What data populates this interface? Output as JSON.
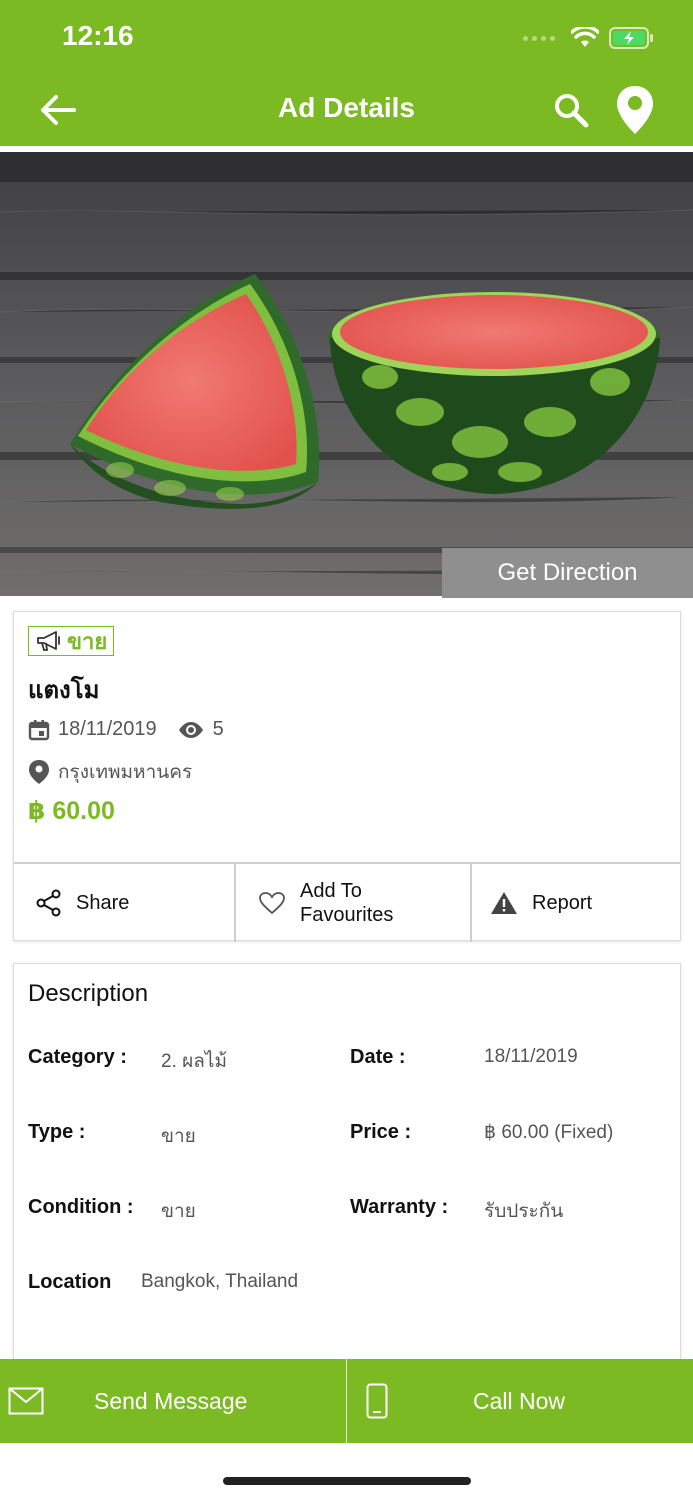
{
  "status_bar": {
    "time": "12:16"
  },
  "header": {
    "title": "Ad Details"
  },
  "hero": {
    "get_direction_label": "Get Direction"
  },
  "ad": {
    "tag": "ขาย",
    "title": "แตงโม",
    "date": "18/11/2019",
    "views": "5",
    "location": "กรุงเทพมหานคร",
    "price": "฿ 60.00"
  },
  "actions": {
    "share": "Share",
    "favourites_line1": "Add To",
    "favourites_line2": "Favourites",
    "report": "Report"
  },
  "description": {
    "title": "Description",
    "category_label": "Category :",
    "category_value": "2. ผลไม้",
    "date_label": "Date :",
    "date_value": "18/11/2019",
    "type_label": "Type :",
    "type_value": "ขาย",
    "price_label": "Price :",
    "price_value": "฿ 60.00 (Fixed)",
    "condition_label": "Condition :",
    "condition_value": "ขาย",
    "warranty_label": "Warranty :",
    "warranty_value": "รับประกัน",
    "location_label": "Location",
    "location_value": "Bangkok, Thailand"
  },
  "bottom_bar": {
    "send_message": "Send Message",
    "call_now": "Call Now"
  },
  "colors": {
    "brand_green": "#7bba22",
    "direction_gray": "#8f8f8f"
  },
  "icons": [
    "back-arrow-icon",
    "search-icon",
    "location-pin-icon",
    "megaphone-icon",
    "calendar-icon",
    "eye-icon",
    "map-marker-icon",
    "share-icon",
    "heart-icon",
    "warning-icon",
    "envelope-icon",
    "phone-icon"
  ]
}
